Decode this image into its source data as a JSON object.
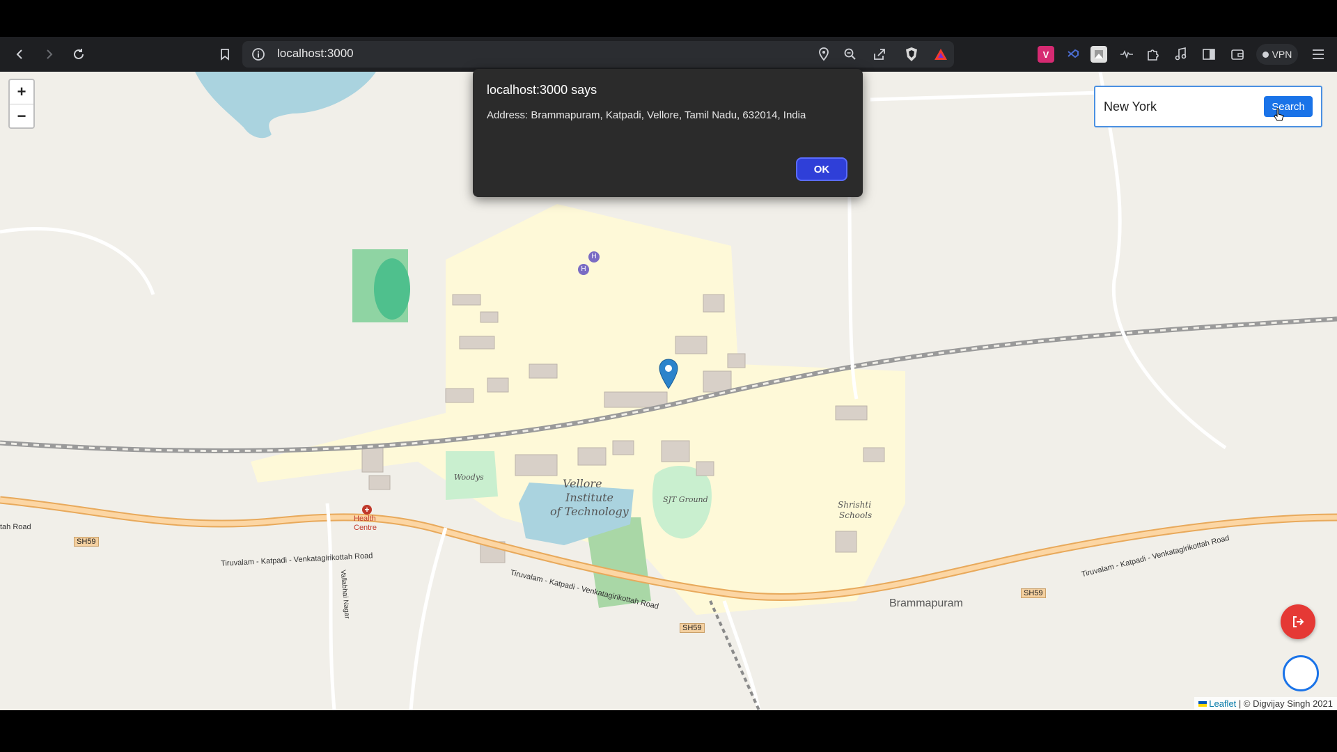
{
  "browser": {
    "address": "localhost:3000",
    "vpn_label": "VPN"
  },
  "map": {
    "zoom_in": "+",
    "zoom_out": "−",
    "labels": {
      "institute": "Vellore Institute of Technology",
      "institute_line1": "Vellore",
      "institute_line2": "Institute",
      "institute_line3": "of Technology",
      "ground": "SJT Ground",
      "woodys": "Woodys",
      "health_line1": "Health",
      "health_line2": "Centre",
      "schools_line1": "Shrishti",
      "schools_line2": "Schools",
      "locality": "Brammapuram",
      "road1": "Tiruvalam - Katpadi - Venkatagirikottah Road",
      "road2": "Tiruvalam - Katpadi - Venkatagirikottah Road",
      "road3": "Tiruvalam - Katpadi - Venkatagirikottah Road",
      "road_left": "tah Road",
      "shield1": "SH59",
      "shield2": "SH59",
      "shield3": "SH59",
      "side_road": "Vallabhai Nagar"
    },
    "attribution_link": "Leaflet",
    "attribution_text": " | © Digvijay Singh 2021"
  },
  "search": {
    "value": "New York",
    "button": "Search"
  },
  "dialog": {
    "title": "localhost:3000 says",
    "message": "Address: Brammapuram, Katpadi, Vellore, Tamil Nadu, 632014, India",
    "ok": "OK"
  }
}
